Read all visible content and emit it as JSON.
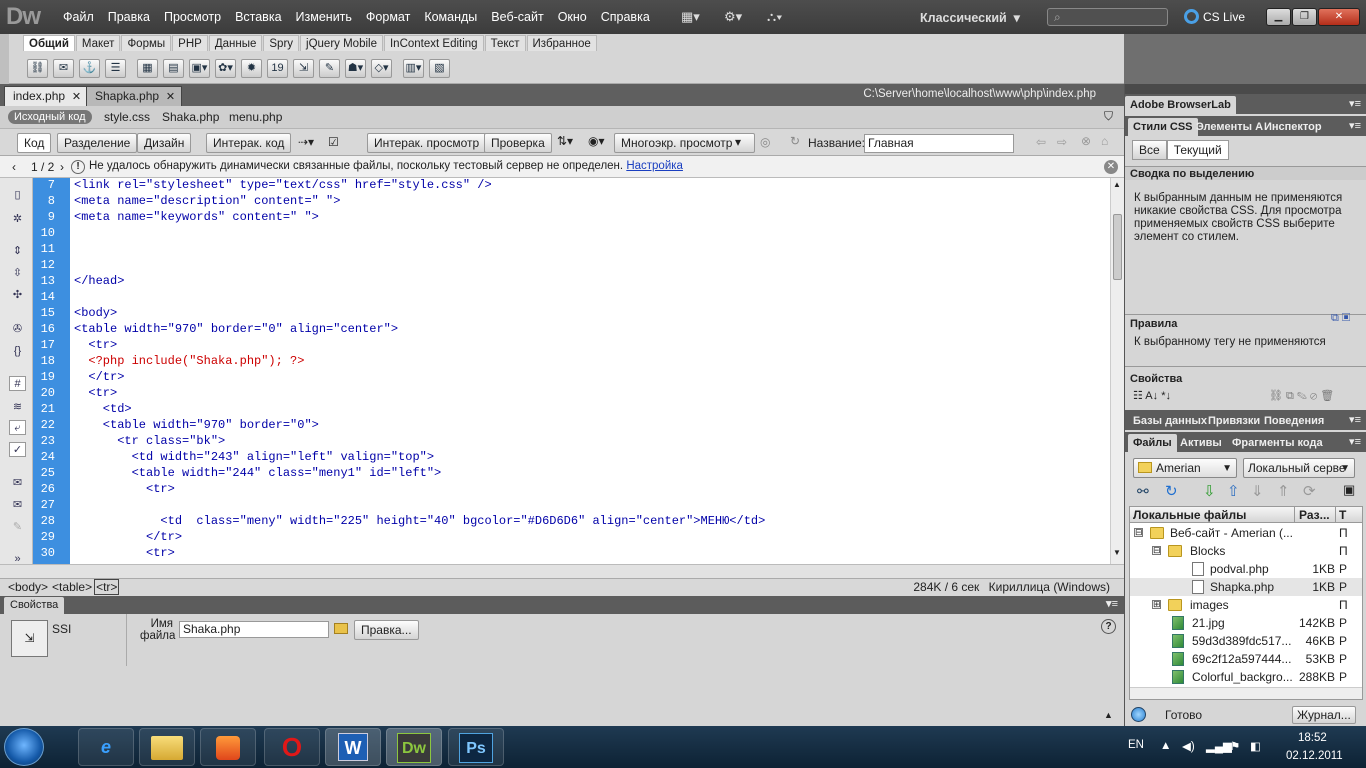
{
  "app": {
    "logo": "Dw"
  },
  "menubar": {
    "menus": [
      "Файл",
      "Правка",
      "Просмотр",
      "Вставка",
      "Изменить",
      "Формат",
      "Команды",
      "Веб-сайт",
      "Окно",
      "Справка"
    ],
    "workspace": "Классический",
    "search_placeholder": "",
    "cs_live": "CS Live"
  },
  "insert_bar": {
    "tabs": [
      "Общий",
      "Макет",
      "Формы",
      "PHP",
      "Данные",
      "Spry",
      "jQuery Mobile",
      "InContext Editing",
      "Текст",
      "Избранное"
    ],
    "active_tab": "Общий"
  },
  "document_tabs": [
    {
      "label": "index.php",
      "active": true
    },
    {
      "label": "Shapka.php",
      "active": false
    }
  ],
  "document_path": "C:\\Server\\home\\localhost\\www\\php\\index.php",
  "related_files": {
    "source": "Исходный код",
    "files": [
      "style.css",
      "Shaka.php",
      "menu.php"
    ]
  },
  "doc_toolbar": {
    "view_buttons": [
      "Код",
      "Разделение",
      "Дизайн"
    ],
    "live_code": "Интерак. код",
    "live_view": "Интерак. просмотр",
    "check": "Проверка",
    "multiscreen": "Многоэкр. просмотр",
    "title_label": "Название:",
    "title_value": "Главная"
  },
  "info_bar": {
    "pager": "1 / 2",
    "message": "Не удалось обнаружить динамически связанные файлы, поскольку тестовый сервер не определен.",
    "link": "Настройка"
  },
  "code": {
    "line_numbers": [
      "7",
      "8",
      "9",
      "10",
      "11",
      "12",
      "13",
      "14",
      "15",
      "16",
      "17",
      "18",
      "19",
      "20",
      "21",
      "22",
      "23",
      "24",
      "25",
      "26",
      "27",
      "28",
      "29",
      "30"
    ],
    "lines": [
      "<link rel=\"stylesheet\" type=\"text/css\" href=\"style.css\" />",
      "<meta name=\"description\" content=\" \">",
      "<meta name=\"keywords\" content=\" \">",
      "",
      "",
      "",
      "</head>",
      "",
      "<body>",
      "<table width=\"970\" border=\"0\" align=\"center\">",
      "  <tr>",
      "  <?php include(\"Shaka.php\"); ?>",
      "  </tr>",
      "  <tr>",
      "    <td>",
      "    <table width=\"970\" border=\"0\">",
      "      <tr class=\"bk\">",
      "        <td width=\"243\" align=\"left\" valign=\"top\">",
      "        <table width=\"244\" class=\"meny1\" id=\"left\">",
      "          <tr>",
      "",
      "            <td  class=\"meny\" width=\"225\" height=\"40\" bgcolor=\"#D6D6D6\" align=\"center\">МЕНЮ</td>",
      "          </tr>",
      "          <tr>"
    ]
  },
  "status_bar": {
    "tags": [
      "<body>",
      "<table>",
      "<tr>"
    ],
    "selected_tag": "<tr>",
    "size_time": "284K / 6 сек",
    "encoding": "Кириллица (Windows)"
  },
  "properties": {
    "title": "Свойства",
    "type": "SSI",
    "file_label": "Имя файла",
    "file_value": "Shaka.php",
    "browse": "Правка..."
  },
  "right_panel": {
    "browserlab": "Adobe BrowserLab",
    "css_tabs": [
      "Стили CSS",
      "Элементы А",
      "Инспектор"
    ],
    "css_buttons": [
      "Все",
      "Текущий"
    ],
    "summary_title": "Сводка по выделению",
    "summary_text": "К выбранным данным не применяются никакие свойства CSS.  Для просмотра применяемых свойств CSS выберите элемент со стилем.",
    "rules_title": "Правила",
    "rules_text": "К выбранному тегу не применяются",
    "props_title": "Свойства",
    "db_tabs": [
      "Базы данных",
      "Привязки",
      "Поведения"
    ],
    "files_tabs": [
      "Файлы",
      "Активы",
      "Фрагменты кода"
    ],
    "site_select": "Amerian",
    "view_select": "Локальный серве",
    "files_header": {
      "name": "Локальные файлы",
      "size": "Раз...",
      "type": "Т"
    },
    "files": [
      {
        "name": "Веб-сайт - Amerian (...",
        "size": "",
        "type": "П",
        "kind": "folder",
        "level": 0,
        "toggle": "⊟"
      },
      {
        "name": "Blocks",
        "size": "",
        "type": "П",
        "kind": "folder",
        "level": 1,
        "toggle": "⊟"
      },
      {
        "name": "podval.php",
        "size": "1KB",
        "type": "P",
        "kind": "file",
        "level": 2,
        "toggle": ""
      },
      {
        "name": "Shapka.php",
        "size": "1KB",
        "type": "P",
        "kind": "file",
        "level": 2,
        "toggle": "",
        "selected": true
      },
      {
        "name": "images",
        "size": "",
        "type": "П",
        "kind": "folder",
        "level": 1,
        "toggle": "⊞"
      },
      {
        "name": "21.jpg",
        "size": "142KB",
        "type": "P",
        "kind": "img",
        "level": 1,
        "toggle": ""
      },
      {
        "name": "59d3d389fdc517...",
        "size": "46KB",
        "type": "P",
        "kind": "img",
        "level": 1,
        "toggle": ""
      },
      {
        "name": "69c2f12a597444...",
        "size": "53KB",
        "type": "P",
        "kind": "img",
        "level": 1,
        "toggle": ""
      },
      {
        "name": "Colorful_backgro...",
        "size": "288KB",
        "type": "P",
        "kind": "img",
        "level": 1,
        "toggle": ""
      }
    ],
    "status": "Готово",
    "log_button": "Журнал..."
  },
  "taskbar": {
    "apps": [
      "e",
      "",
      "",
      "O",
      "W",
      "Dw",
      "Ps"
    ],
    "lang": "EN",
    "time": "18:52",
    "date": "02.12.2011"
  },
  "colors": {
    "gutter": "#3d8fe0",
    "tag": "#0000a8",
    "php": "#cc0000",
    "dw": "#5a8a1f",
    "ps": "#1c4e85"
  }
}
